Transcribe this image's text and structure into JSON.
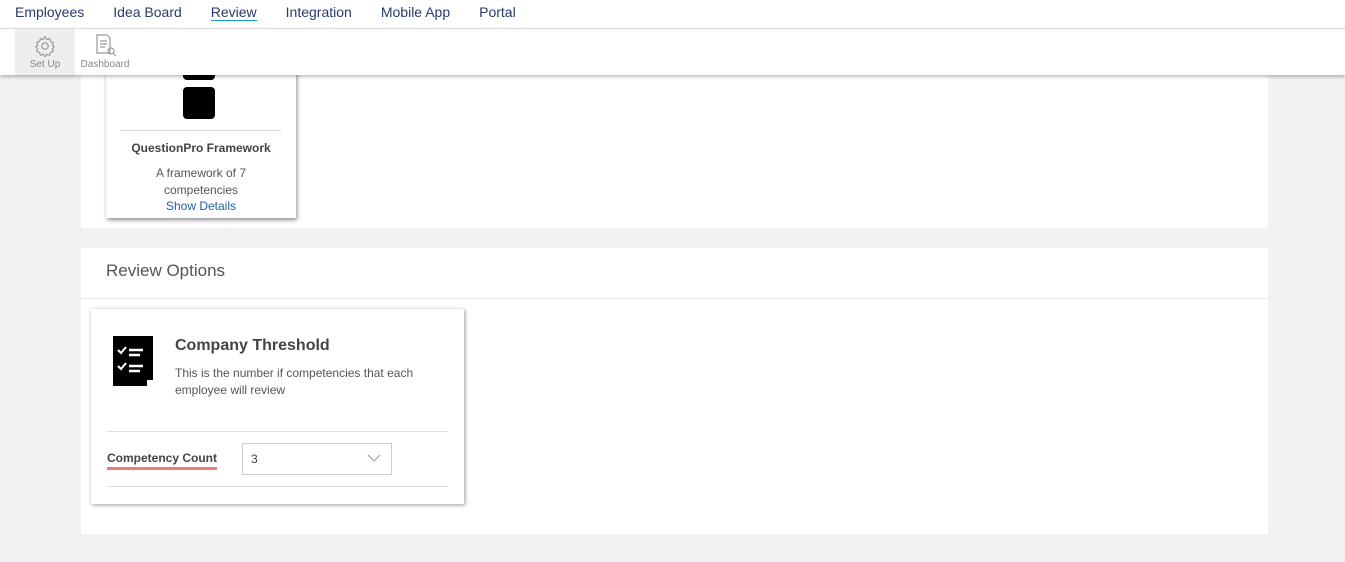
{
  "nav": {
    "items": [
      "Employees",
      "Idea Board",
      "Review",
      "Integration",
      "Mobile App",
      "Portal"
    ],
    "active": "Review"
  },
  "toolbar": {
    "setup": "Set Up",
    "dashboard": "Dashboard"
  },
  "framework": {
    "title": "QuestionPro Framework",
    "desc": "A framework of 7 competencies",
    "link": "Show Details"
  },
  "review_options": {
    "heading": "Review Options",
    "threshold": {
      "title": "Company Threshold",
      "desc": "This is the number if competencies that each employee will review",
      "field_label": "Competency Count",
      "value": "3"
    }
  },
  "colors": {
    "accent": "#1a9bd7",
    "underline": "#f07b7b",
    "link": "#1e5ea8"
  }
}
